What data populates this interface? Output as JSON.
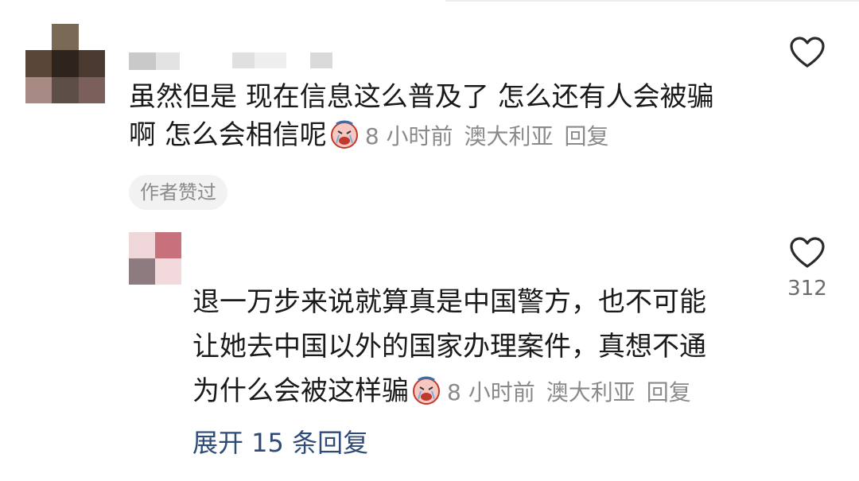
{
  "comment1": {
    "text_line1": "虽然但是 现在信息这么普及了 怎么还有人会被骗",
    "text_line2": "啊 怎么会相信呢",
    "emoji": "crying-face-emoji",
    "time": "8 小时前",
    "location": "澳大利亚",
    "reply_label": "回复",
    "author_liked_badge": "作者赞过"
  },
  "reply1": {
    "text_line1": "退一万步来说就算真是中国警方，也不可能",
    "text_line2": "让她去中国以外的国家办理案件，真想不通",
    "text_line3": "为什么会被这样骗",
    "emoji": "crying-face-emoji",
    "time": "8 小时前",
    "location": "澳大利亚",
    "reply_label": "回复",
    "like_count": "312"
  },
  "expand_replies": "展开 15 条回复",
  "colors": {
    "link": "#2e4b78",
    "meta": "#8a8a8a",
    "badge_bg": "#f2f2f2"
  }
}
